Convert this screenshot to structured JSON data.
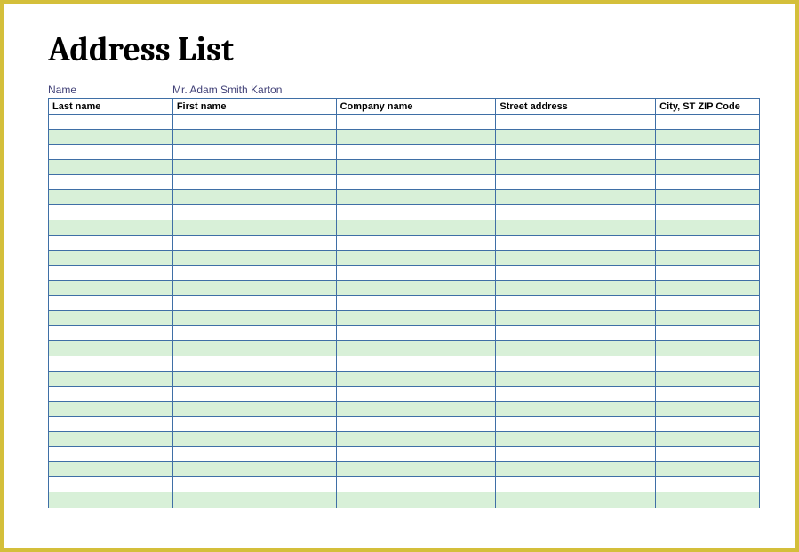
{
  "title": "Address List",
  "nameLabel": "Name",
  "nameValue": "Mr. Adam Smith Karton",
  "columns": [
    {
      "label": "Last name"
    },
    {
      "label": "First name"
    },
    {
      "label": "Company name"
    },
    {
      "label": "Street address"
    },
    {
      "label": "City, ST  ZIP Code"
    }
  ],
  "rowCount": 26
}
